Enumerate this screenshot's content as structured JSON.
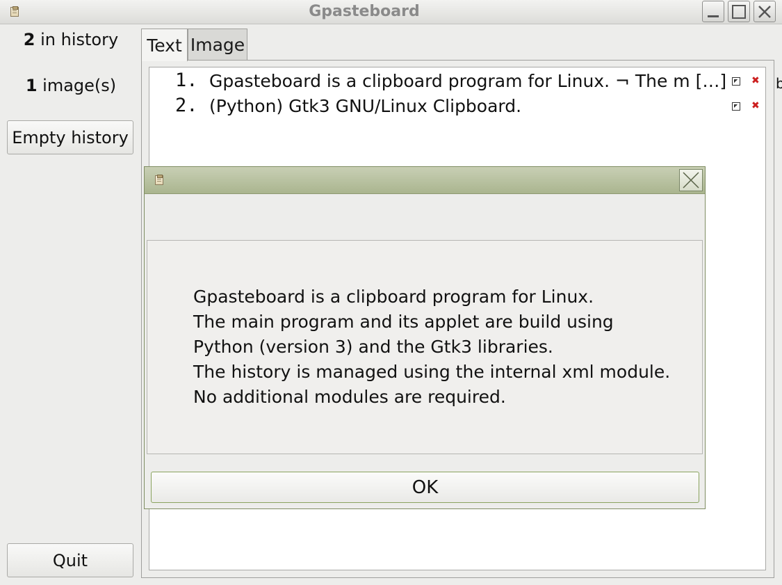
{
  "window": {
    "title": "Gpasteboard"
  },
  "sidebar": {
    "history_count": "2",
    "history_suffix": " in history",
    "image_count": "1",
    "image_suffix": " image(s)",
    "empty_button": "Empty history",
    "quit_button": "Quit"
  },
  "tabs": [
    {
      "label": "Text",
      "active": true
    },
    {
      "label": "Image",
      "active": false
    }
  ],
  "history": [
    {
      "number": "1.",
      "text": "Gpasteboard is a clipboard program for Linux. ¬ The m […]"
    },
    {
      "number": "2.",
      "text": "(Python) Gtk3 GNU/Linux Clipboard."
    }
  ],
  "dialog": {
    "lines": [
      "Gpasteboard is a clipboard program for Linux.",
      "The main program and its applet are build using",
      "Python (version 3) and the Gtk3 libraries.",
      "The history is managed using the internal xml module.",
      "No additional modules are required."
    ],
    "ok_button": "OK"
  },
  "colors": {
    "dialog_titlebar": "#aab58f",
    "delete_icon": "#cc1f1f",
    "ok_border": "#8aa35e"
  }
}
